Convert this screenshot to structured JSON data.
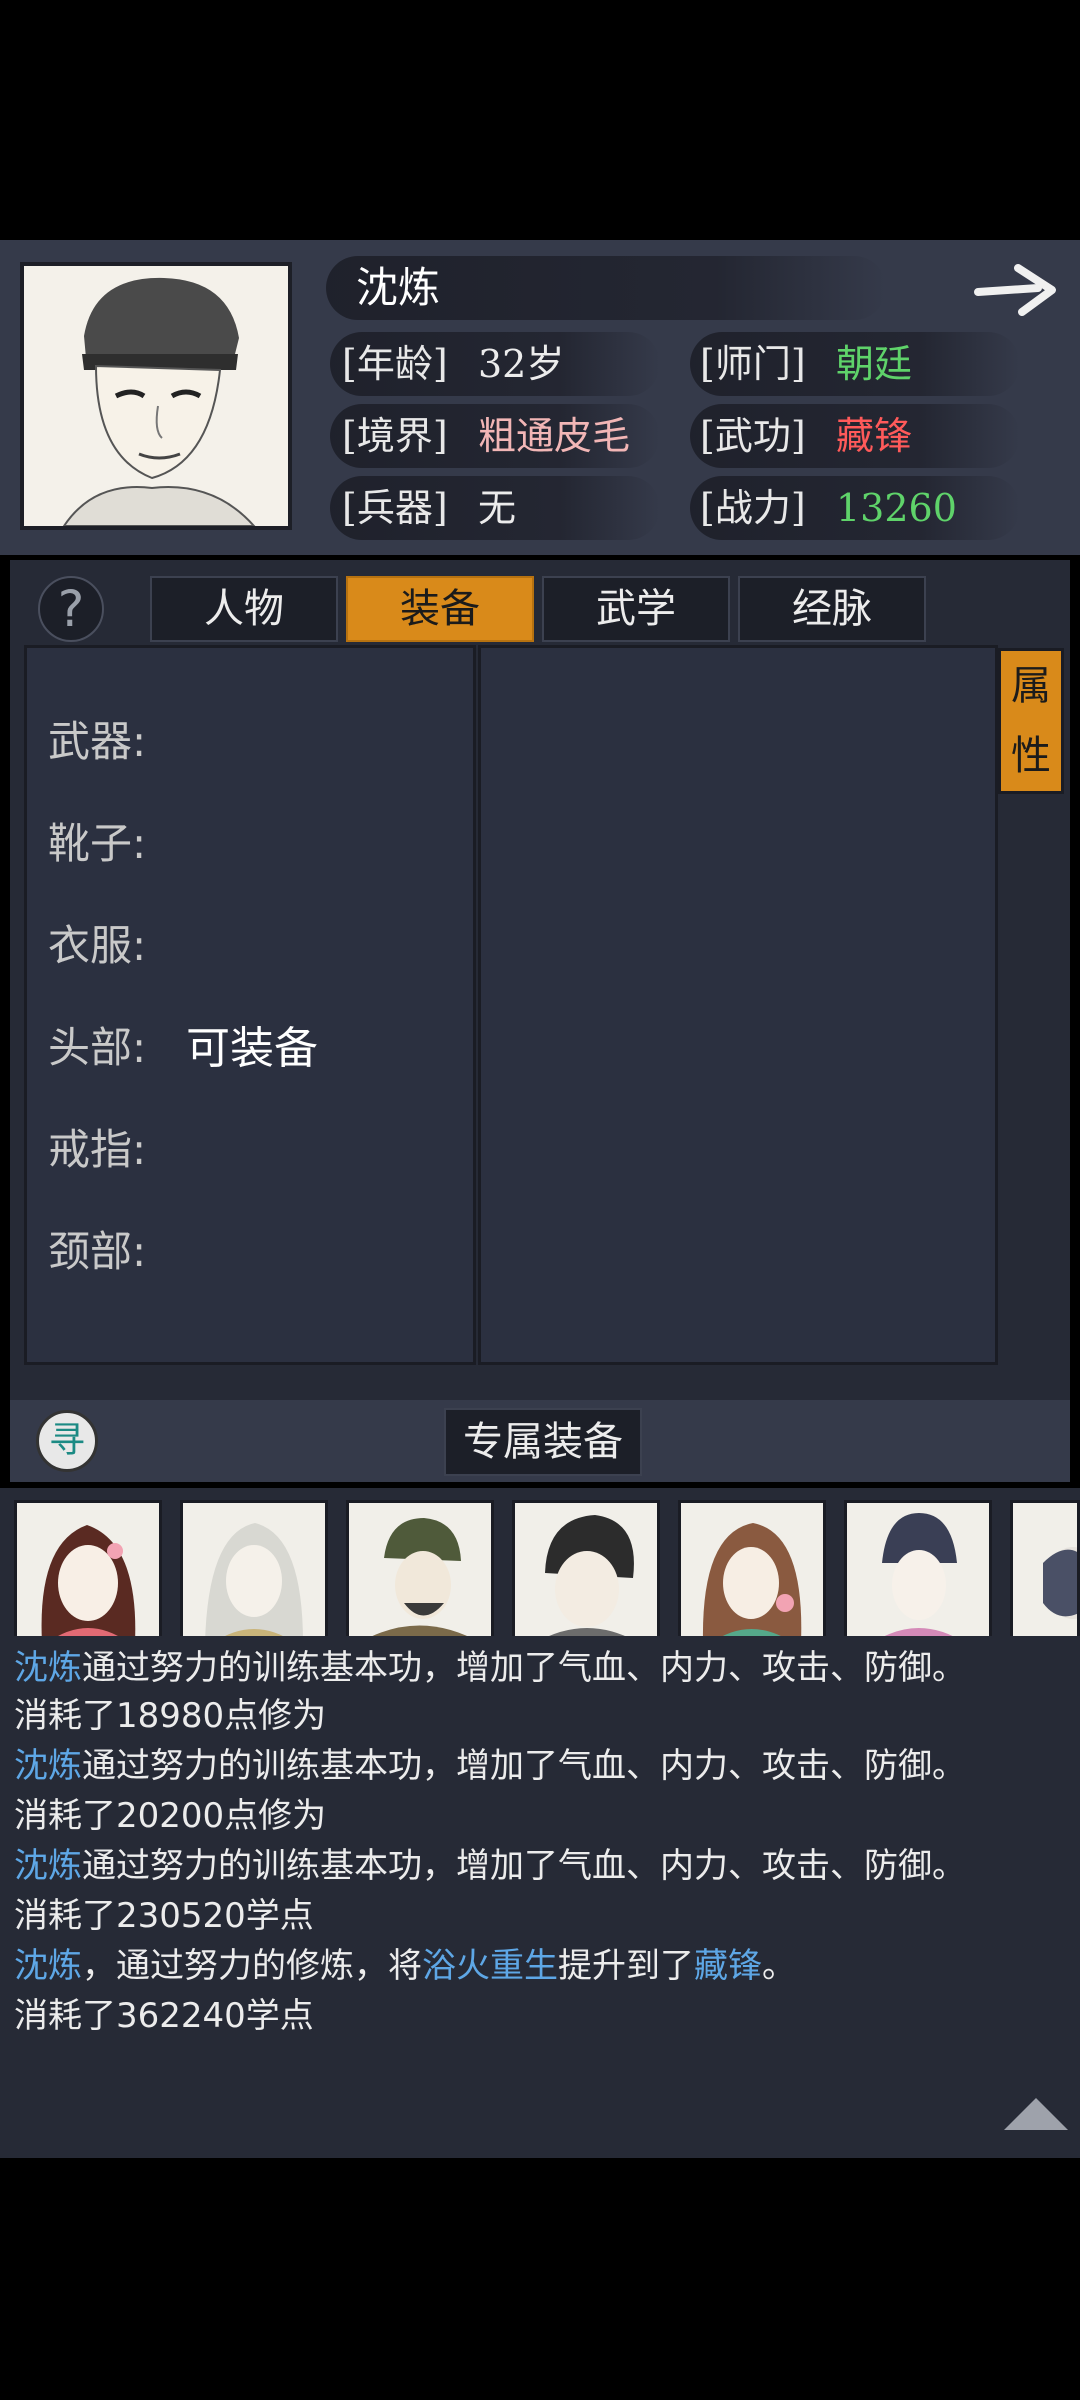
{
  "character": {
    "name": "沈炼",
    "age_label": "[年龄]",
    "age_value": "32岁",
    "sect_label": "[师门]",
    "sect_value": "朝廷",
    "realm_label": "[境界]",
    "realm_value": "粗通皮毛",
    "kungfu_label": "[武功]",
    "kungfu_value": "藏锋",
    "weapon_label": "[兵器]",
    "weapon_value": "无",
    "power_label": "[战力]",
    "power_value": "13260"
  },
  "tabs": [
    "人物",
    "装备",
    "武学",
    "经脉"
  ],
  "active_tab": "装备",
  "help_icon": "?",
  "attribute_tab": [
    "属",
    "性"
  ],
  "equipment_slots": [
    {
      "label": "武器:",
      "value": ""
    },
    {
      "label": "靴子:",
      "value": ""
    },
    {
      "label": "衣服:",
      "value": ""
    },
    {
      "label": "头部:",
      "value": "可装备"
    },
    {
      "label": "戒指:",
      "value": ""
    },
    {
      "label": "颈部:",
      "value": ""
    }
  ],
  "find_icon": "寻",
  "exclusive_button": "专属装备",
  "log": {
    "lines": [
      [
        {
          "t": "沈炼",
          "hl": true
        },
        {
          "t": "通过努力的训练基本功，增加了气血、内力、攻击、防御。",
          "hl": false
        }
      ],
      [
        {
          "t": "消耗了18980点修为",
          "hl": false
        }
      ],
      [
        {
          "t": "沈炼",
          "hl": true
        },
        {
          "t": "通过努力的训练基本功，增加了气血、内力、攻击、防御。",
          "hl": false
        }
      ],
      [
        {
          "t": "消耗了20200点修为",
          "hl": false
        }
      ],
      [
        {
          "t": "沈炼",
          "hl": true
        },
        {
          "t": "通过努力的训练基本功，增加了气血、内力、攻击、防御。",
          "hl": false
        }
      ],
      [
        {
          "t": "消耗了230520学点",
          "hl": false
        }
      ],
      [
        {
          "t": "沈炼",
          "hl": true
        },
        {
          "t": "，通过努力的修炼，将",
          "hl": false
        },
        {
          "t": "浴火重生",
          "hl": true
        },
        {
          "t": "提升到了",
          "hl": false
        },
        {
          "t": "藏锋",
          "hl": true
        },
        {
          "t": "。",
          "hl": false
        }
      ],
      [
        {
          "t": "消耗了362240学点",
          "hl": false
        }
      ]
    ]
  },
  "colors": {
    "accent": "#d98a1a",
    "sect": "#5fd36a",
    "realm": "#f2b6b6",
    "kungfu": "#ff5a5a",
    "power": "#5fd36a",
    "highlight": "#5ea7e6"
  }
}
